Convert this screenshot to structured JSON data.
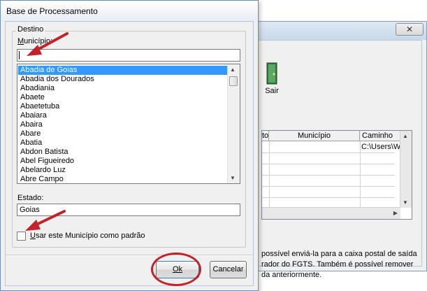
{
  "dialog": {
    "title": "Base de Processamento",
    "group_title": "Destino",
    "municipio_label": "Município:",
    "municipio_value": "",
    "municipios": [
      "Abadia de Goias",
      "Abadia dos Dourados",
      "Abadiania",
      "Abaete",
      "Abaetetuba",
      "Abaiara",
      "Abaira",
      "Abare",
      "Abatia",
      "Abdon Batista",
      "Abel Figueiredo",
      "Abelardo Luz",
      "Abre Campo"
    ],
    "selected_municipio": "Abadia de Goias",
    "estado_label": "Estado:",
    "estado_value": "Goias",
    "padrao_label": "Usar este Município como padrão",
    "padrao_checked": false,
    "ok_label": "Ok",
    "cancel_label": "Cancelar"
  },
  "background_window": {
    "sair_label": "Sair",
    "grid_columns": [
      "to",
      "Município",
      "Caminho"
    ],
    "grid_first_row_path": "C:\\Users\\Wi",
    "info_lines": [
      "possível enviá-la para a caixa postal de saída",
      "rador do FGTS. Também é possível remover",
      "da anteriormente."
    ]
  },
  "colors": {
    "selection": "#3399ff",
    "annotation_red": "#c0242a"
  }
}
